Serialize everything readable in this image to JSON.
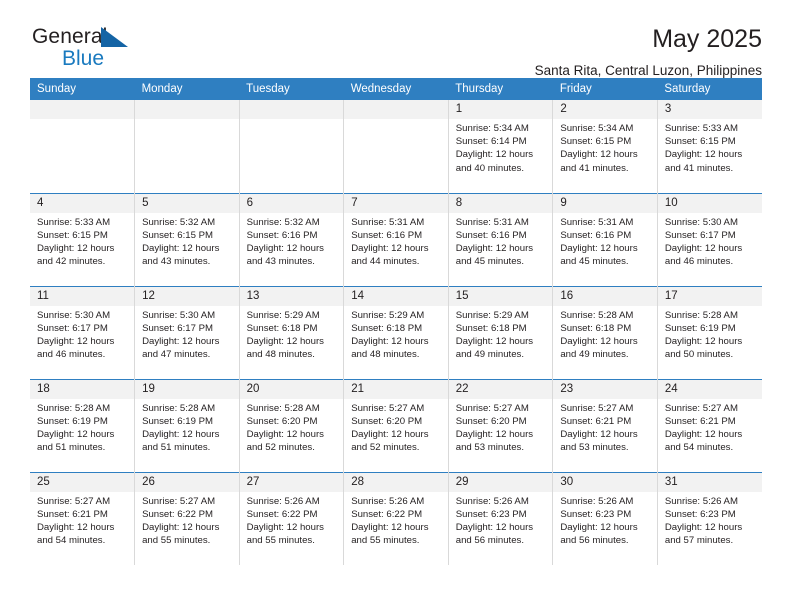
{
  "brand": {
    "name_part1": "General",
    "name_part2": "Blue",
    "triangle_color": "#1464a5",
    "blue_color": "#1a7abf"
  },
  "header": {
    "title": "May 2025",
    "subtitle": "Santa Rita, Central Luzon, Philippines"
  },
  "theme": {
    "header_bg": "#2f7fc1",
    "daynum_bg": "#f2f2f2",
    "text": "#231f20",
    "cell_border": "#d9d9d9"
  },
  "weekdays": [
    {
      "label": "Sunday"
    },
    {
      "label": "Monday"
    },
    {
      "label": "Tuesday"
    },
    {
      "label": "Wednesday"
    },
    {
      "label": "Thursday"
    },
    {
      "label": "Friday"
    },
    {
      "label": "Saturday"
    }
  ],
  "labels": {
    "sunrise_prefix": "Sunrise:",
    "sunset_prefix": "Sunset:",
    "daylight_prefix": "Daylight:"
  },
  "weeks": [
    [
      {
        "day": "",
        "sunrise": "",
        "sunset": "",
        "daylight_line1": "",
        "daylight_line2": ""
      },
      {
        "day": "",
        "sunrise": "",
        "sunset": "",
        "daylight_line1": "",
        "daylight_line2": ""
      },
      {
        "day": "",
        "sunrise": "",
        "sunset": "",
        "daylight_line1": "",
        "daylight_line2": ""
      },
      {
        "day": "",
        "sunrise": "",
        "sunset": "",
        "daylight_line1": "",
        "daylight_line2": ""
      },
      {
        "day": "1",
        "sunrise": "Sunrise: 5:34 AM",
        "sunset": "Sunset: 6:14 PM",
        "daylight_line1": "Daylight: 12 hours",
        "daylight_line2": "and 40 minutes."
      },
      {
        "day": "2",
        "sunrise": "Sunrise: 5:34 AM",
        "sunset": "Sunset: 6:15 PM",
        "daylight_line1": "Daylight: 12 hours",
        "daylight_line2": "and 41 minutes."
      },
      {
        "day": "3",
        "sunrise": "Sunrise: 5:33 AM",
        "sunset": "Sunset: 6:15 PM",
        "daylight_line1": "Daylight: 12 hours",
        "daylight_line2": "and 41 minutes."
      }
    ],
    [
      {
        "day": "4",
        "sunrise": "Sunrise: 5:33 AM",
        "sunset": "Sunset: 6:15 PM",
        "daylight_line1": "Daylight: 12 hours",
        "daylight_line2": "and 42 minutes."
      },
      {
        "day": "5",
        "sunrise": "Sunrise: 5:32 AM",
        "sunset": "Sunset: 6:15 PM",
        "daylight_line1": "Daylight: 12 hours",
        "daylight_line2": "and 43 minutes."
      },
      {
        "day": "6",
        "sunrise": "Sunrise: 5:32 AM",
        "sunset": "Sunset: 6:16 PM",
        "daylight_line1": "Daylight: 12 hours",
        "daylight_line2": "and 43 minutes."
      },
      {
        "day": "7",
        "sunrise": "Sunrise: 5:31 AM",
        "sunset": "Sunset: 6:16 PM",
        "daylight_line1": "Daylight: 12 hours",
        "daylight_line2": "and 44 minutes."
      },
      {
        "day": "8",
        "sunrise": "Sunrise: 5:31 AM",
        "sunset": "Sunset: 6:16 PM",
        "daylight_line1": "Daylight: 12 hours",
        "daylight_line2": "and 45 minutes."
      },
      {
        "day": "9",
        "sunrise": "Sunrise: 5:31 AM",
        "sunset": "Sunset: 6:16 PM",
        "daylight_line1": "Daylight: 12 hours",
        "daylight_line2": "and 45 minutes."
      },
      {
        "day": "10",
        "sunrise": "Sunrise: 5:30 AM",
        "sunset": "Sunset: 6:17 PM",
        "daylight_line1": "Daylight: 12 hours",
        "daylight_line2": "and 46 minutes."
      }
    ],
    [
      {
        "day": "11",
        "sunrise": "Sunrise: 5:30 AM",
        "sunset": "Sunset: 6:17 PM",
        "daylight_line1": "Daylight: 12 hours",
        "daylight_line2": "and 46 minutes."
      },
      {
        "day": "12",
        "sunrise": "Sunrise: 5:30 AM",
        "sunset": "Sunset: 6:17 PM",
        "daylight_line1": "Daylight: 12 hours",
        "daylight_line2": "and 47 minutes."
      },
      {
        "day": "13",
        "sunrise": "Sunrise: 5:29 AM",
        "sunset": "Sunset: 6:18 PM",
        "daylight_line1": "Daylight: 12 hours",
        "daylight_line2": "and 48 minutes."
      },
      {
        "day": "14",
        "sunrise": "Sunrise: 5:29 AM",
        "sunset": "Sunset: 6:18 PM",
        "daylight_line1": "Daylight: 12 hours",
        "daylight_line2": "and 48 minutes."
      },
      {
        "day": "15",
        "sunrise": "Sunrise: 5:29 AM",
        "sunset": "Sunset: 6:18 PM",
        "daylight_line1": "Daylight: 12 hours",
        "daylight_line2": "and 49 minutes."
      },
      {
        "day": "16",
        "sunrise": "Sunrise: 5:28 AM",
        "sunset": "Sunset: 6:18 PM",
        "daylight_line1": "Daylight: 12 hours",
        "daylight_line2": "and 49 minutes."
      },
      {
        "day": "17",
        "sunrise": "Sunrise: 5:28 AM",
        "sunset": "Sunset: 6:19 PM",
        "daylight_line1": "Daylight: 12 hours",
        "daylight_line2": "and 50 minutes."
      }
    ],
    [
      {
        "day": "18",
        "sunrise": "Sunrise: 5:28 AM",
        "sunset": "Sunset: 6:19 PM",
        "daylight_line1": "Daylight: 12 hours",
        "daylight_line2": "and 51 minutes."
      },
      {
        "day": "19",
        "sunrise": "Sunrise: 5:28 AM",
        "sunset": "Sunset: 6:19 PM",
        "daylight_line1": "Daylight: 12 hours",
        "daylight_line2": "and 51 minutes."
      },
      {
        "day": "20",
        "sunrise": "Sunrise: 5:28 AM",
        "sunset": "Sunset: 6:20 PM",
        "daylight_line1": "Daylight: 12 hours",
        "daylight_line2": "and 52 minutes."
      },
      {
        "day": "21",
        "sunrise": "Sunrise: 5:27 AM",
        "sunset": "Sunset: 6:20 PM",
        "daylight_line1": "Daylight: 12 hours",
        "daylight_line2": "and 52 minutes."
      },
      {
        "day": "22",
        "sunrise": "Sunrise: 5:27 AM",
        "sunset": "Sunset: 6:20 PM",
        "daylight_line1": "Daylight: 12 hours",
        "daylight_line2": "and 53 minutes."
      },
      {
        "day": "23",
        "sunrise": "Sunrise: 5:27 AM",
        "sunset": "Sunset: 6:21 PM",
        "daylight_line1": "Daylight: 12 hours",
        "daylight_line2": "and 53 minutes."
      },
      {
        "day": "24",
        "sunrise": "Sunrise: 5:27 AM",
        "sunset": "Sunset: 6:21 PM",
        "daylight_line1": "Daylight: 12 hours",
        "daylight_line2": "and 54 minutes."
      }
    ],
    [
      {
        "day": "25",
        "sunrise": "Sunrise: 5:27 AM",
        "sunset": "Sunset: 6:21 PM",
        "daylight_line1": "Daylight: 12 hours",
        "daylight_line2": "and 54 minutes."
      },
      {
        "day": "26",
        "sunrise": "Sunrise: 5:27 AM",
        "sunset": "Sunset: 6:22 PM",
        "daylight_line1": "Daylight: 12 hours",
        "daylight_line2": "and 55 minutes."
      },
      {
        "day": "27",
        "sunrise": "Sunrise: 5:26 AM",
        "sunset": "Sunset: 6:22 PM",
        "daylight_line1": "Daylight: 12 hours",
        "daylight_line2": "and 55 minutes."
      },
      {
        "day": "28",
        "sunrise": "Sunrise: 5:26 AM",
        "sunset": "Sunset: 6:22 PM",
        "daylight_line1": "Daylight: 12 hours",
        "daylight_line2": "and 55 minutes."
      },
      {
        "day": "29",
        "sunrise": "Sunrise: 5:26 AM",
        "sunset": "Sunset: 6:23 PM",
        "daylight_line1": "Daylight: 12 hours",
        "daylight_line2": "and 56 minutes."
      },
      {
        "day": "30",
        "sunrise": "Sunrise: 5:26 AM",
        "sunset": "Sunset: 6:23 PM",
        "daylight_line1": "Daylight: 12 hours",
        "daylight_line2": "and 56 minutes."
      },
      {
        "day": "31",
        "sunrise": "Sunrise: 5:26 AM",
        "sunset": "Sunset: 6:23 PM",
        "daylight_line1": "Daylight: 12 hours",
        "daylight_line2": "and 57 minutes."
      }
    ]
  ]
}
